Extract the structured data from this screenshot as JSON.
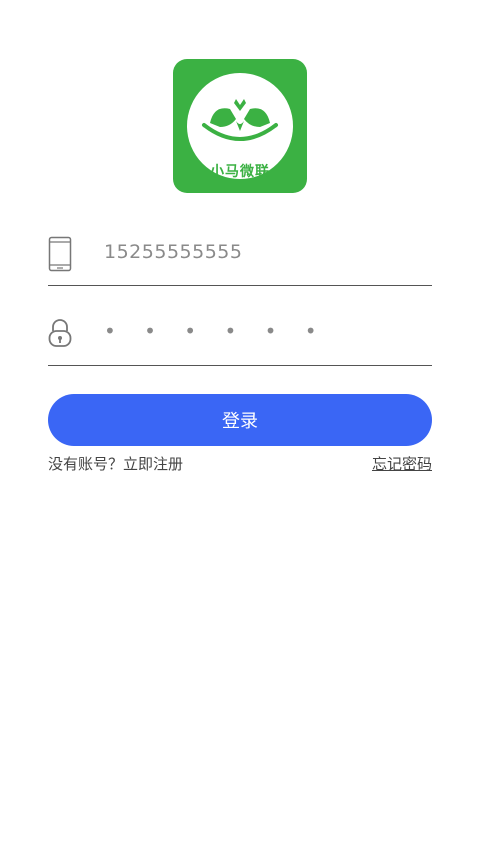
{
  "logo": {
    "icon": "horse-heart-logo-icon",
    "text": "小马微联",
    "brand_color": "#3bb143"
  },
  "phone": {
    "icon": "mobile-phone-icon",
    "value": "15255555555"
  },
  "password": {
    "icon": "lock-icon",
    "value": "• • • • • •"
  },
  "login_button": {
    "label": "登录",
    "color": "#3a66f5"
  },
  "links": {
    "register": "没有账号？立即注册",
    "forgot": "忘记密码"
  }
}
